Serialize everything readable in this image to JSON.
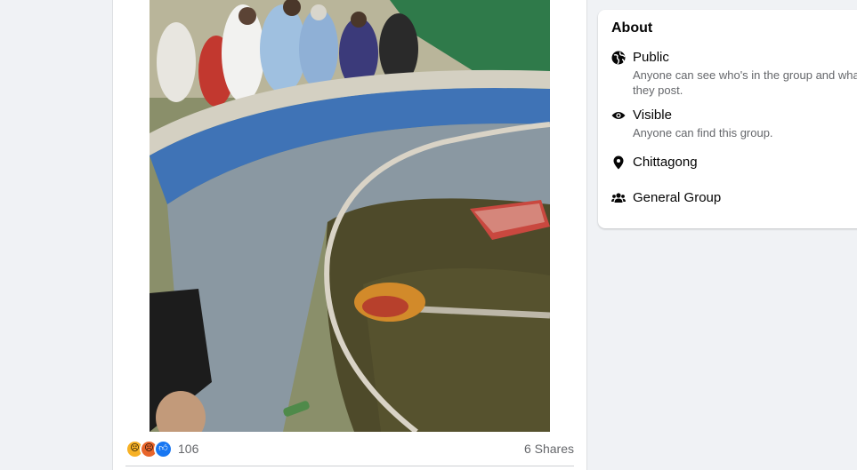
{
  "post": {
    "reactions": {
      "icons": [
        "sad-reaction-icon",
        "angry-reaction-icon",
        "like-reaction-icon"
      ],
      "count": "106"
    },
    "shares": "6 Shares"
  },
  "about": {
    "title": "About",
    "items": [
      {
        "icon": "globe-icon",
        "label": "Public",
        "description": "Anyone can see who's in the group and what they post."
      },
      {
        "icon": "eye-icon",
        "label": "Visible",
        "description": "Anyone can find this group."
      },
      {
        "icon": "location-pin-icon",
        "label": "Chittagong"
      },
      {
        "icon": "people-icon",
        "label": "General Group"
      }
    ]
  },
  "colors": {
    "page_background": "#f0f2f5",
    "card_background": "#ffffff",
    "secondary_text": "#65676b",
    "like_blue": "#1877f2"
  }
}
